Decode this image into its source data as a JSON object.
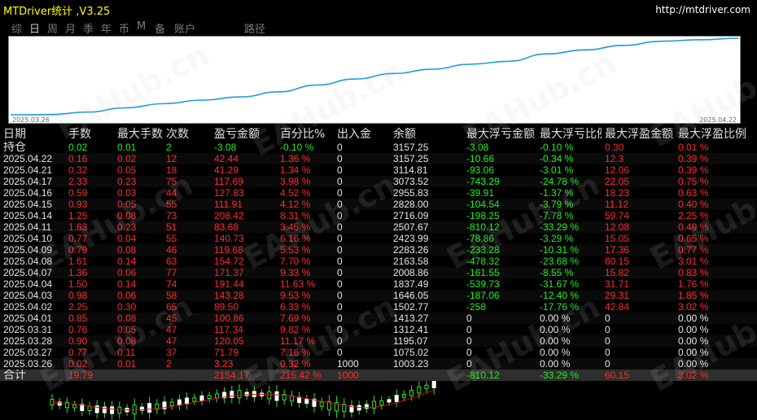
{
  "window": {
    "title": "MTDriver统计 ,V3.25",
    "url": "http://mtdriver.com"
  },
  "tabs": [
    {
      "label": "综",
      "active": false
    },
    {
      "label": "日",
      "active": true
    },
    {
      "label": "周",
      "active": false
    },
    {
      "label": "月",
      "active": false
    },
    {
      "label": "季",
      "active": false
    },
    {
      "label": "年",
      "active": false
    },
    {
      "label": "币",
      "active": false
    },
    {
      "label": "M",
      "active": false
    },
    {
      "label": "备",
      "active": false
    },
    {
      "label": "账户",
      "active": false
    },
    {
      "label": "路径",
      "active": false
    }
  ],
  "equity_chart": {
    "start_date": "2025.03.26",
    "end_date": "2025.04.22",
    "line_color": "#1e9be0",
    "points": [
      1000,
      1003.23,
      1075.02,
      1195.07,
      1312.41,
      1413.27,
      1502.77,
      1646.05,
      1837.49,
      2008.86,
      2163.58,
      2283.26,
      2423.99,
      2507.67,
      2716.09,
      2828,
      2955.83,
      3073.52,
      3114.81,
      3157.25
    ]
  },
  "table": {
    "headers": [
      "日期",
      "手数",
      "最大手数",
      "次数",
      "盈亏金额",
      "百分比%",
      "出入金",
      "余额",
      "最大浮亏金额",
      "最大浮亏比例",
      "最大浮盈金额",
      "最大浮盈比例"
    ],
    "rows": [
      {
        "date": "持仓",
        "lots": "0.02",
        "max_lots": "0.01",
        "count": "2",
        "pnl": "-3.08",
        "pct": "-0.10 %",
        "io": "0",
        "balance": "3157.25",
        "fl_amt": "-3.08",
        "fl_pct": "-0.10 %",
        "fp_amt": "0.30",
        "fp_pct": "0.01 %"
      },
      {
        "date": "2025.04.22",
        "lots": "0.16",
        "max_lots": "0.02",
        "count": "12",
        "pnl": "42.44",
        "pct": "1.36 %",
        "io": "0",
        "balance": "3157.25",
        "fl_amt": "-10.66",
        "fl_pct": "-0.34 %",
        "fp_amt": "12.3",
        "fp_pct": "0.39 %"
      },
      {
        "date": "2025.04.21",
        "lots": "0.32",
        "max_lots": "0.05",
        "count": "18",
        "pnl": "41.29",
        "pct": "1.34 %",
        "io": "0",
        "balance": "3114.81",
        "fl_amt": "-93.06",
        "fl_pct": "-3.01 %",
        "fp_amt": "12.06",
        "fp_pct": "0.39 %"
      },
      {
        "date": "2025.04.17",
        "lots": "2.33",
        "max_lots": "0.23",
        "count": "75",
        "pnl": "117.69",
        "pct": "3.98 %",
        "io": "0",
        "balance": "3073.52",
        "fl_amt": "-743.29",
        "fl_pct": "-24.78 %",
        "fp_amt": "22.05",
        "fp_pct": "0.75 %"
      },
      {
        "date": "2025.04.16",
        "lots": "0.59",
        "max_lots": "0.03",
        "count": "44",
        "pnl": "127.83",
        "pct": "4.52 %",
        "io": "0",
        "balance": "2955.83",
        "fl_amt": "-39.91",
        "fl_pct": "-1.37 %",
        "fp_amt": "18.23",
        "fp_pct": "0.63 %"
      },
      {
        "date": "2025.04.15",
        "lots": "0.93",
        "max_lots": "0.05",
        "count": "55",
        "pnl": "111.91",
        "pct": "4.12 %",
        "io": "0",
        "balance": "2828.00",
        "fl_amt": "-104.54",
        "fl_pct": "-3.79 %",
        "fp_amt": "11.12",
        "fp_pct": "0.40 %"
      },
      {
        "date": "2025.04.14",
        "lots": "1.25",
        "max_lots": "0.08",
        "count": "73",
        "pnl": "208.42",
        "pct": "8.31 %",
        "io": "0",
        "balance": "2716.09",
        "fl_amt": "-198.25",
        "fl_pct": "-7.78 %",
        "fp_amt": "59.74",
        "fp_pct": "2.25 %"
      },
      {
        "date": "2025.04.11",
        "lots": "1.63",
        "max_lots": "0.23",
        "count": "51",
        "pnl": "83.68",
        "pct": "3.45 %",
        "io": "0",
        "balance": "2507.67",
        "fl_amt": "-810.12",
        "fl_pct": "-33.29 %",
        "fp_amt": "12.08",
        "fp_pct": "0.49 %"
      },
      {
        "date": "2025.04.10",
        "lots": "0.77",
        "max_lots": "0.04",
        "count": "55",
        "pnl": "140.73",
        "pct": "6.16 %",
        "io": "0",
        "balance": "2423.99",
        "fl_amt": "-78.86",
        "fl_pct": "-3.29 %",
        "fp_amt": "15.05",
        "fp_pct": "0.65 %"
      },
      {
        "date": "2025.04.09",
        "lots": "0.79",
        "max_lots": "0.08",
        "count": "46",
        "pnl": "119.68",
        "pct": "5.53 %",
        "io": "0",
        "balance": "2283.26",
        "fl_amt": "-233.28",
        "fl_pct": "-10.31 %",
        "fp_amt": "17.36",
        "fp_pct": "0.77 %"
      },
      {
        "date": "2025.04.08",
        "lots": "1.61",
        "max_lots": "0.14",
        "count": "63",
        "pnl": "154.72",
        "pct": "7.70 %",
        "io": "0",
        "balance": "2163.58",
        "fl_amt": "-478.32",
        "fl_pct": "-23.68 %",
        "fp_amt": "60.15",
        "fp_pct": "3.01 %"
      },
      {
        "date": "2025.04.07",
        "lots": "1.36",
        "max_lots": "0.06",
        "count": "77",
        "pnl": "171.37",
        "pct": "9.33 %",
        "io": "0",
        "balance": "2008.86",
        "fl_amt": "-161.55",
        "fl_pct": "-8.55 %",
        "fp_amt": "15.82",
        "fp_pct": "0.83 %"
      },
      {
        "date": "2025.04.04",
        "lots": "1.50",
        "max_lots": "0.14",
        "count": "74",
        "pnl": "191.44",
        "pct": "11.63 %",
        "io": "0",
        "balance": "1837.49",
        "fl_amt": "-539.73",
        "fl_pct": "-31.67 %",
        "fp_amt": "31.71",
        "fp_pct": "1.76 %"
      },
      {
        "date": "2025.04.03",
        "lots": "0.98",
        "max_lots": "0.06",
        "count": "58",
        "pnl": "143.28",
        "pct": "9.53 %",
        "io": "0",
        "balance": "1646.05",
        "fl_amt": "-187.06",
        "fl_pct": "-12.40 %",
        "fp_amt": "29.31",
        "fp_pct": "1.85 %"
      },
      {
        "date": "2025.04.02",
        "lots": "2.25",
        "max_lots": "0.30",
        "count": "65",
        "pnl": "89.50",
        "pct": "6.33 %",
        "io": "0",
        "balance": "1502.77",
        "fl_amt": "-258",
        "fl_pct": "-17.76 %",
        "fp_amt": "42.84",
        "fp_pct": "3.02 %"
      },
      {
        "date": "2025.04.01",
        "lots": "0.85",
        "max_lots": "0.08",
        "count": "45",
        "pnl": "100.86",
        "pct": "7.69 %",
        "io": "0",
        "balance": "1413.27",
        "fl_amt": "0",
        "fl_pct": "0.00 %",
        "fp_amt": "0",
        "fp_pct": "0.00 %"
      },
      {
        "date": "2025.03.31",
        "lots": "0.76",
        "max_lots": "0.05",
        "count": "47",
        "pnl": "117.34",
        "pct": "9.82 %",
        "io": "0",
        "balance": "1312.41",
        "fl_amt": "0",
        "fl_pct": "0.00 %",
        "fp_amt": "0",
        "fp_pct": "0.00 %"
      },
      {
        "date": "2025.03.28",
        "lots": "0.90",
        "max_lots": "0.08",
        "count": "47",
        "pnl": "120.05",
        "pct": "11.17 %",
        "io": "0",
        "balance": "1195.07",
        "fl_amt": "0",
        "fl_pct": "0.00 %",
        "fp_amt": "0",
        "fp_pct": "0.00 %"
      },
      {
        "date": "2025.03.27",
        "lots": "0.77",
        "max_lots": "0.11",
        "count": "37",
        "pnl": "71.79",
        "pct": "7.16 %",
        "io": "0",
        "balance": "1075.02",
        "fl_amt": "0",
        "fl_pct": "0.00 %",
        "fp_amt": "0",
        "fp_pct": "0.00 %"
      },
      {
        "date": "2025.03.26",
        "lots": "0.02",
        "max_lots": "0.01",
        "count": "2",
        "pnl": "3.23",
        "pct": "0.32 %",
        "io": "1000",
        "balance": "1003.23",
        "fl_amt": "0",
        "fl_pct": "0.00 %",
        "fp_amt": "0",
        "fp_pct": "0.00 %"
      }
    ],
    "totals": {
      "date": "合计",
      "lots": "19.79",
      "max_lots": "",
      "count": "",
      "pnl": "2154.17",
      "pct": "215.42 %",
      "io": "1000",
      "balance": "",
      "fl_amt": "-810.12",
      "fl_pct": "-33.29 %",
      "fp_amt": "60.15",
      "fp_pct": "3.02 %"
    }
  },
  "watermark": "EAHub.cn",
  "colors": {
    "profit": "#ff2a2a",
    "loss": "#22ee22",
    "title": "#ffff00",
    "equity_line": "#1e9be0",
    "ma_line": "#cc1111"
  }
}
